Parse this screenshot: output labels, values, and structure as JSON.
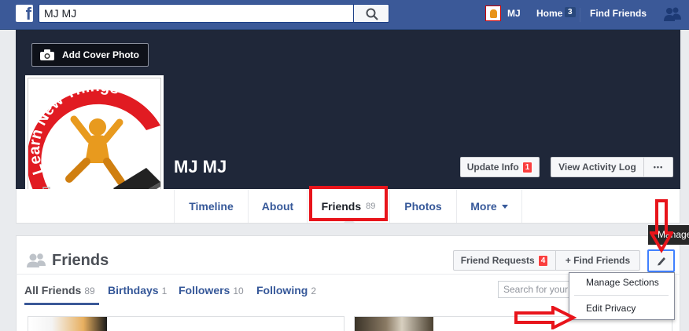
{
  "topbar": {
    "logo": "f",
    "search_value": "MJ MJ",
    "user_name": "MJ",
    "home_label": "Home",
    "home_count": "3",
    "find_friends_label": "Find Friends"
  },
  "cover": {
    "add_cover_label": "Add Cover Photo"
  },
  "profile": {
    "name": "MJ MJ",
    "picture_text": "Learn New Things",
    "update_info_label": "Update Info",
    "update_info_count": "1",
    "activity_log_label": "View Activity Log",
    "more_dots": "•••"
  },
  "tabs": [
    {
      "label": "Timeline"
    },
    {
      "label": "About"
    },
    {
      "label": "Friends",
      "count": "89"
    },
    {
      "label": "Photos"
    },
    {
      "label": "More"
    }
  ],
  "friends_section": {
    "title": "Friends",
    "friend_requests_label": "Friend Requests",
    "friend_requests_count": "4",
    "find_friends_label": "+ Find Friends",
    "search_placeholder": "Search for your friends",
    "subtabs": [
      {
        "label": "All Friends",
        "count": "89"
      },
      {
        "label": "Birthdays",
        "count": "1"
      },
      {
        "label": "Followers",
        "count": "10"
      },
      {
        "label": "Following",
        "count": "2"
      }
    ]
  },
  "dropdown": {
    "items": [
      {
        "label": "Manage Sections"
      },
      {
        "label": "Edit Privacy"
      }
    ]
  },
  "tooltip": {
    "text": "Manage"
  },
  "colors": {
    "facebook_blue": "#3b5998",
    "cover_dark": "#1f2739",
    "highlight_red": "#e8141b",
    "badge_red": "#fa3e3e",
    "link_blue": "#365899"
  }
}
